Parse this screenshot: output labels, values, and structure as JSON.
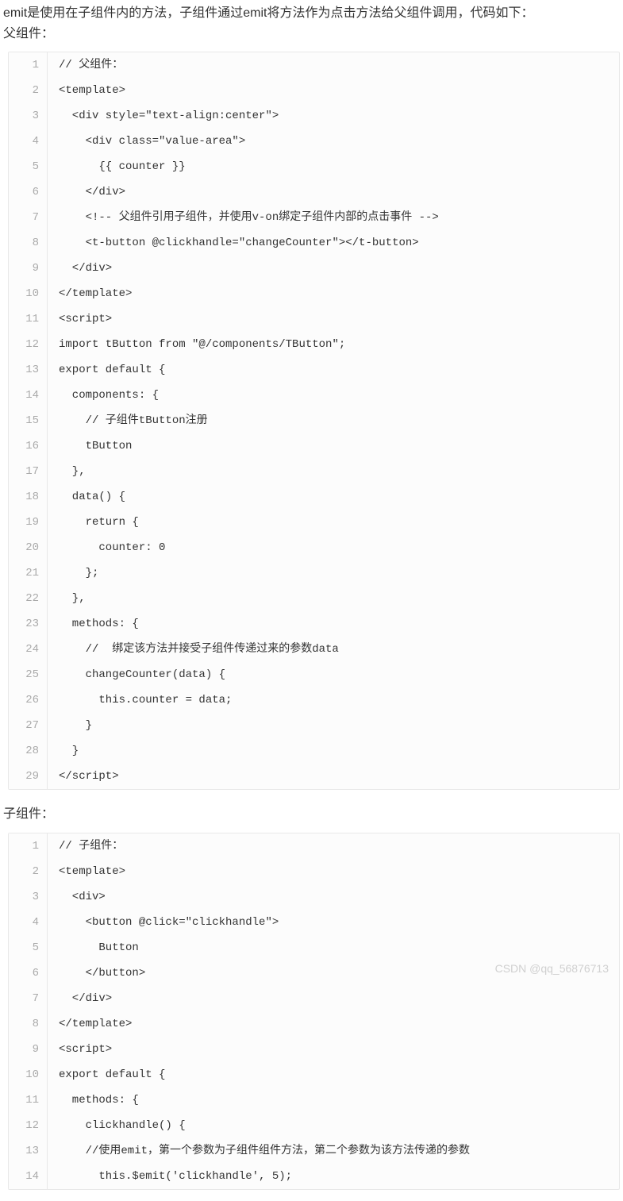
{
  "intro_text": "emit是使用在子组件内的方法，子组件通过emit将方法作为点击方法给父组件调用，代码如下：",
  "parent_label": "父组件：",
  "child_label": "子组件：",
  "watermark": "CSDN @qq_56876713",
  "code_parent": {
    "lines": [
      "// 父组件：",
      "<template>",
      "  <div style=\"text-align:center\">",
      "    <div class=\"value-area\">",
      "      {{ counter }}",
      "    </div>",
      "    <!-- 父组件引用子组件，并使用v-on绑定子组件内部的点击事件 -->",
      "    <t-button @clickhandle=\"changeCounter\"></t-button>",
      "  </div>",
      "</template>",
      "<script>",
      "import tButton from \"@/components/TButton\";",
      "export default {",
      "  components: {",
      "    // 子组件tButton注册",
      "    tButton",
      "  },",
      "  data() {",
      "    return {",
      "      counter: 0",
      "    };",
      "  },",
      "  methods: {",
      "    //  绑定该方法并接受子组件传递过来的参数data",
      "    changeCounter(data) {",
      "      this.counter = data;",
      "    }",
      "  }",
      "</script>"
    ]
  },
  "code_child": {
    "lines": [
      "// 子组件：",
      "<template>",
      "  <div>",
      "    <button @click=\"clickhandle\">",
      "      Button",
      "    </button>",
      "  </div>",
      "</template>",
      "<script>",
      "export default {",
      "  methods: {",
      "    clickhandle() {",
      "    //使用emit，第一个参数为子组件组件方法，第二个参数为该方法传递的参数",
      "      this.$emit('clickhandle', 5);"
    ]
  }
}
